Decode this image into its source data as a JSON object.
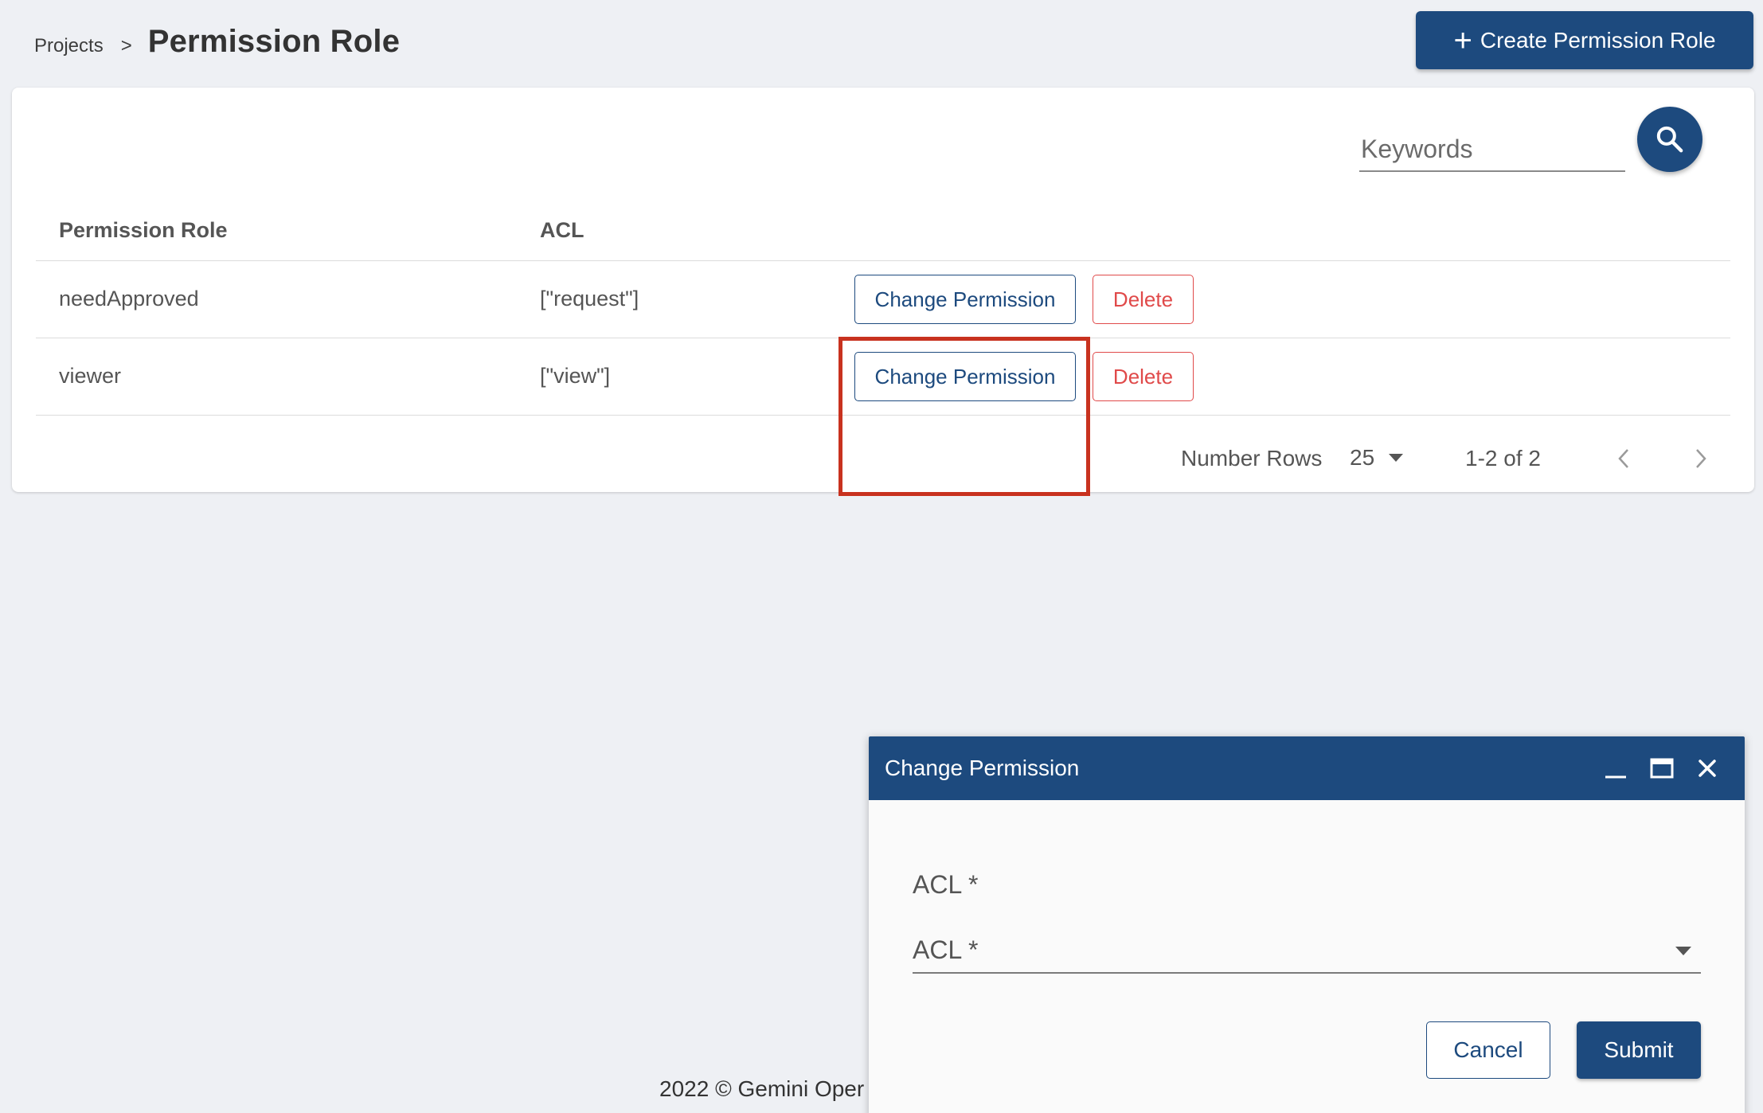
{
  "header": {
    "breadcrumb_parent": "Projects",
    "breadcrumb_separator": ">",
    "title": "Permission Role",
    "create_label": "Create Permission Role"
  },
  "search": {
    "placeholder": "Keywords",
    "value": ""
  },
  "table": {
    "columns": [
      "Permission Role",
      "ACL"
    ],
    "rows": [
      {
        "role": "needApproved",
        "acl": "[\"request\"]",
        "change_label": "Change Permission",
        "delete_label": "Delete"
      },
      {
        "role": "viewer",
        "acl": "[\"view\"]",
        "change_label": "Change Permission",
        "delete_label": "Delete"
      }
    ]
  },
  "pagination": {
    "label": "Number Rows",
    "rows_per_page": "25",
    "range": "1-2 of 2"
  },
  "footer": {
    "text": "2022 © Gemini Oper"
  },
  "dialog": {
    "title": "Change Permission",
    "field_label": "ACL *",
    "select_placeholder": "ACL *",
    "cancel_label": "Cancel",
    "submit_label": "Submit"
  },
  "colors": {
    "primary": "#1d4a7e",
    "danger": "#e04a4a",
    "highlight": "#c8321f",
    "background": "#eef0f4"
  },
  "icons": [
    "plus-icon",
    "search-icon",
    "chevron-left-icon",
    "chevron-right-icon",
    "dropdown-caret-icon",
    "minimize-icon",
    "maximize-icon",
    "close-icon"
  ]
}
